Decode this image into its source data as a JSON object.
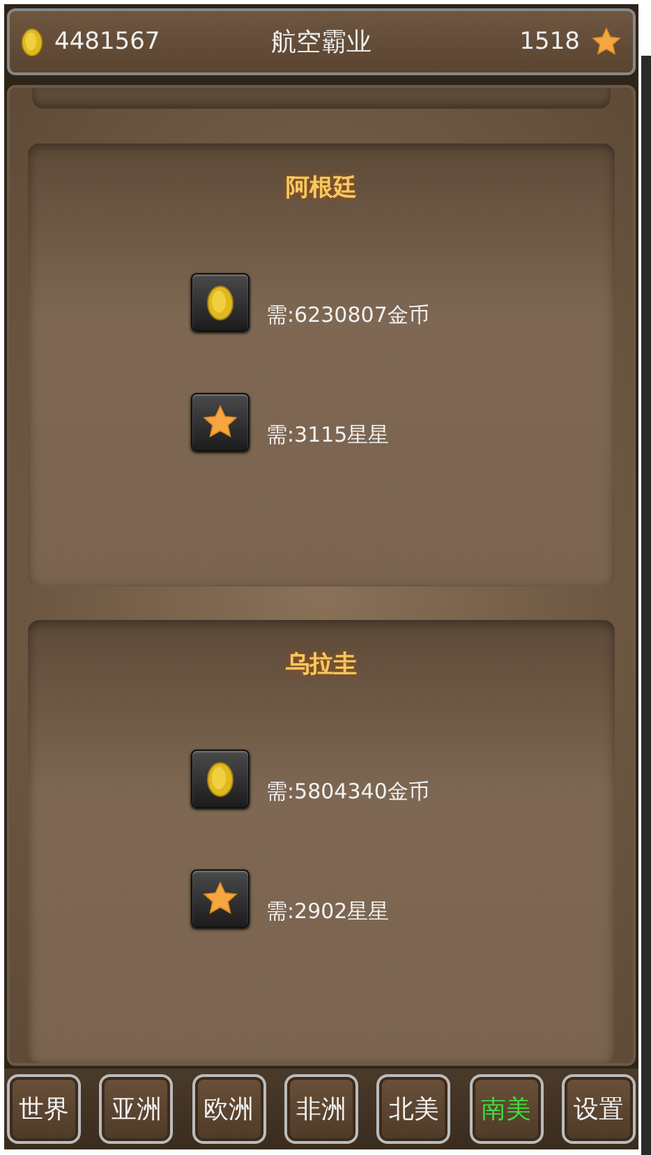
{
  "header": {
    "coins": "4481567",
    "title": "航空霸业",
    "stars_count": "1518"
  },
  "cards": [
    {
      "title": "阿根廷",
      "requirements": [
        {
          "kind": "coin",
          "text": "需:6230807金币"
        },
        {
          "kind": "star",
          "text": "需:3115星星"
        }
      ]
    },
    {
      "title": "乌拉圭",
      "requirements": [
        {
          "kind": "coin",
          "text": "需:5804340金币"
        },
        {
          "kind": "star",
          "text": "需:2902星星"
        }
      ]
    }
  ],
  "tabs": [
    {
      "label": "世界",
      "selected": false
    },
    {
      "label": "亚洲",
      "selected": false
    },
    {
      "label": "欧洲",
      "selected": false
    },
    {
      "label": "非洲",
      "selected": false
    },
    {
      "label": "北美",
      "selected": false
    },
    {
      "label": "南美",
      "selected": true
    },
    {
      "label": "设置",
      "selected": false
    }
  ]
}
